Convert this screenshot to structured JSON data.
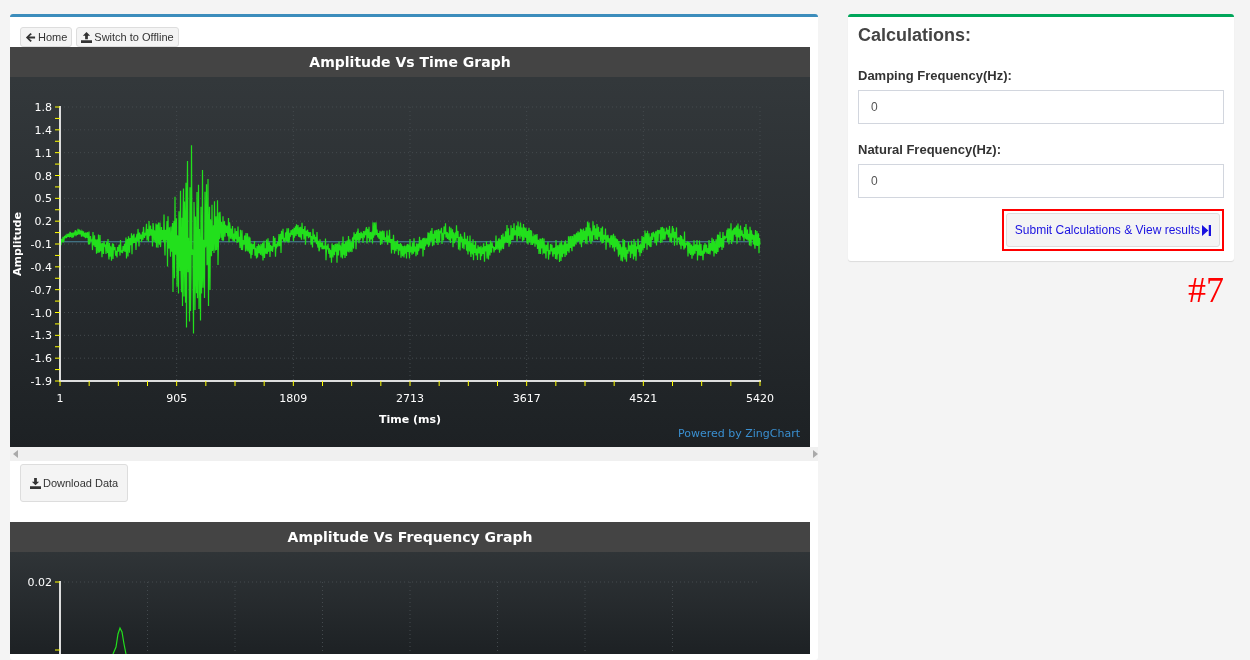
{
  "toolbar": {
    "buttons": [
      {
        "label": "Home",
        "kind": "back"
      },
      {
        "label": "Switch to Offline",
        "kind": "upload"
      }
    ]
  },
  "charts": [
    {
      "kind": "time",
      "title": "Amplitude Vs Time Graph",
      "ylabel": "Amplitude",
      "xlabel": "Time (ms)",
      "yticks": [
        "1.8",
        "1.4",
        "1.1",
        "0.8",
        "0.5",
        "0.2",
        "-0.1",
        "-0.4",
        "-0.7",
        "-1.0",
        "-1.3",
        "-1.6",
        "-1.9"
      ],
      "xticks": [
        "1",
        "905",
        "1809",
        "2713",
        "3617",
        "4521",
        "5420"
      ],
      "credit": "Powered by ZingChart"
    },
    {
      "kind": "frequency",
      "title": "Amplitude Vs Frequency Graph",
      "yticks": [
        "0.02"
      ]
    }
  ],
  "download": {
    "label": "Download Data"
  },
  "calculations": {
    "title": "Calculations:",
    "fields": [
      {
        "label": "Damping Frequency(Hz):",
        "value": "0"
      },
      {
        "label": "Natural Frequency(Hz):",
        "value": "0"
      }
    ],
    "submit": {
      "label": "Submit Calculations & View results",
      "highlighted": true
    },
    "annotation": "#7"
  }
}
